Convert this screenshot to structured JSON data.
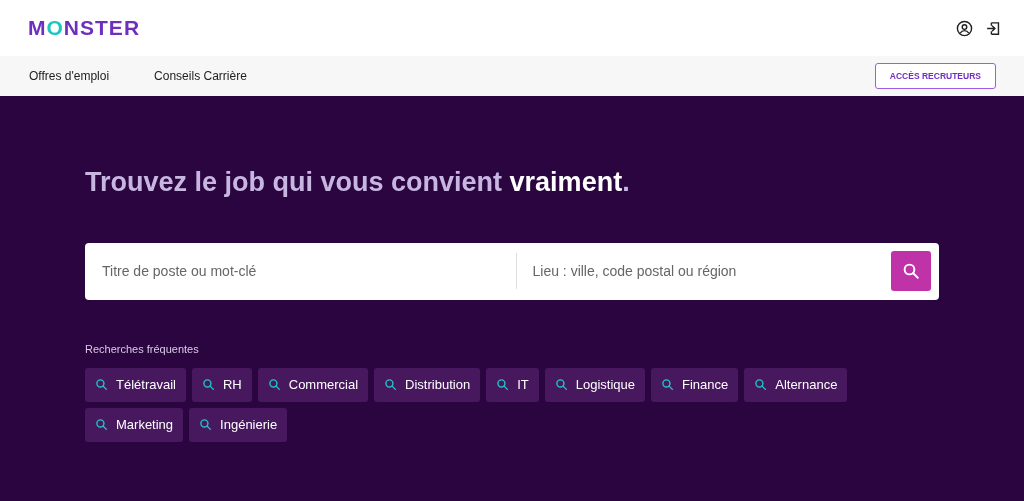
{
  "header": {
    "logo": "MONSTER"
  },
  "nav": {
    "links": [
      "Offres d'emploi",
      "Conseils Carrière"
    ],
    "recruiter_button": "ACCÈS RECRUTEURS"
  },
  "hero": {
    "headline": "Trouvez le job qui vous convient **vraiment**.",
    "search": {
      "keyword_placeholder": "Titre de poste ou mot-clé",
      "location_placeholder": "Lieu : ville, code postal ou région"
    },
    "frequent_label": "Recherches fréquentes",
    "chips": [
      "Télétravail",
      "RH",
      "Commercial",
      "Distribution",
      "IT",
      "Logistique",
      "Finance",
      "Alternance",
      "Marketing",
      "Ingénierie"
    ]
  }
}
